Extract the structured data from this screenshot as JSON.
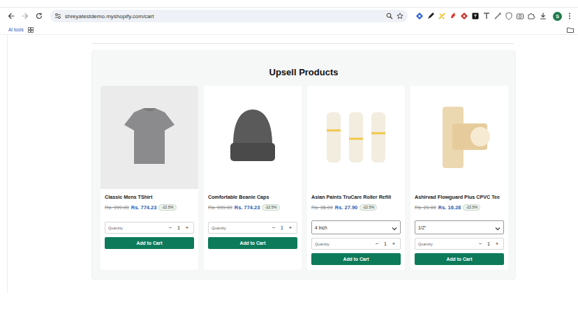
{
  "browser": {
    "url": "shreyatestdemo.myshopify.com/cart",
    "bookmarks": [
      "AI tools"
    ],
    "profile": "S"
  },
  "section": {
    "title": "Upsell Products"
  },
  "products": [
    {
      "kind": "simple",
      "name": "Classic Mens TShirt",
      "compare_price": "Rs. 999.00",
      "price": "Rs. 774.23",
      "discount": "-22.5%",
      "quantity_label": "Quantity",
      "minus": "−",
      "quantity": "1",
      "plus": "+",
      "button": "Add to Cart"
    },
    {
      "kind": "simple",
      "name": "Comfortable Beanie Caps",
      "compare_price": "Rs. 999.00",
      "price": "Rs. 774.23",
      "discount": "-22.5%",
      "quantity_label": "Quantity",
      "minus": "−",
      "quantity": "1",
      "plus": "+",
      "button": "Add to Cart"
    },
    {
      "kind": "variant",
      "name": "Asian Paints TruCare Roller Refill",
      "compare_price": "Rs. 36.00",
      "price": "Rs. 27.90",
      "discount": "-22.5%",
      "variant": "4 Inch",
      "quantity_label": "Quantity",
      "minus": "−",
      "quantity": "1",
      "plus": "+",
      "button": "Add to Cart"
    },
    {
      "kind": "variant",
      "name": "Ashirvad Flowguard Plus CPVC Tee",
      "compare_price": "Rs. 21.00",
      "price": "Rs. 16.28",
      "discount": "-22.5%",
      "variant": "1/2\"",
      "quantity_label": "Quantity",
      "minus": "−",
      "quantity": "1",
      "plus": "+",
      "button": "Add to Cart"
    }
  ]
}
